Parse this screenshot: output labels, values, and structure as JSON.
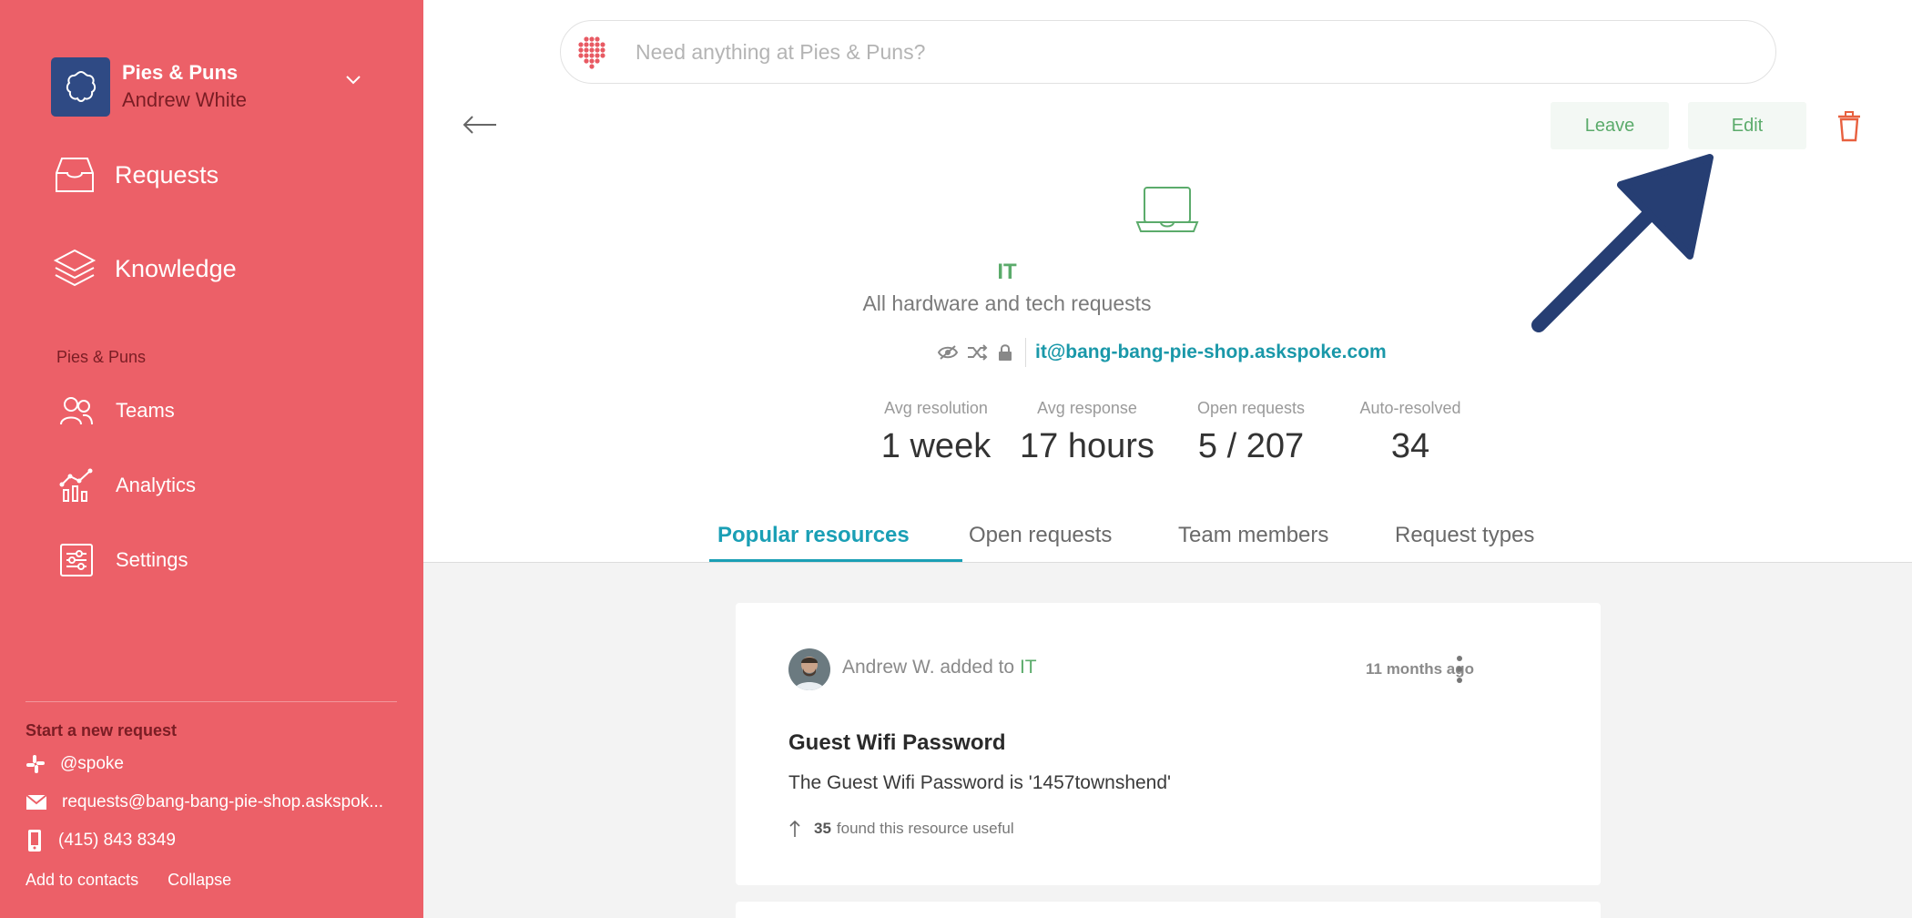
{
  "sidebar": {
    "org_name": "Pies & Puns",
    "user_name": "Andrew White",
    "nav_main": [
      {
        "label": "Requests",
        "icon": "inbox-icon"
      },
      {
        "label": "Knowledge",
        "icon": "layers-icon"
      }
    ],
    "section_label": "Pies & Puns",
    "nav_sub": [
      {
        "label": "Teams",
        "icon": "people-icon"
      },
      {
        "label": "Analytics",
        "icon": "analytics-icon"
      },
      {
        "label": "Settings",
        "icon": "settings-sliders-icon"
      }
    ],
    "start_request_title": "Start a new request",
    "contacts": [
      {
        "label": "@spoke",
        "icon": "slack-icon"
      },
      {
        "label": "requests@bang-bang-pie-shop.askspok...",
        "icon": "mail-icon"
      },
      {
        "label": "(415) 843 8349",
        "icon": "phone-icon"
      }
    ],
    "add_to_contacts": "Add to contacts",
    "collapse": "Collapse"
  },
  "search": {
    "placeholder": "Need anything at Pies & Puns?"
  },
  "header": {
    "leave_label": "Leave",
    "edit_label": "Edit"
  },
  "team": {
    "name": "IT",
    "description": "All hardware and tech requests",
    "email": "it@bang-bang-pie-shop.askspoke.com"
  },
  "stats": [
    {
      "label": "Avg resolution",
      "value": "1 week"
    },
    {
      "label": "Avg response",
      "value": "17 hours"
    },
    {
      "label": "Open requests",
      "value": "5 / 207"
    },
    {
      "label": "Auto-resolved",
      "value": "34"
    }
  ],
  "tabs": [
    {
      "label": "Popular resources",
      "active": true
    },
    {
      "label": "Open requests",
      "active": false
    },
    {
      "label": "Team members",
      "active": false
    },
    {
      "label": "Request types",
      "active": false
    }
  ],
  "resource": {
    "author_text": "Andrew W. added to",
    "team_link": "IT",
    "time": "11 months ago",
    "title": "Guest Wifi Password",
    "body": "The Guest Wifi Password is '1457townshend'",
    "useful_count": "35",
    "useful_text": "found this resource useful"
  },
  "colors": {
    "sidebar": "#ec6068",
    "accent_green": "#5bab6b",
    "accent_teal": "#1a9fb5",
    "annotation_arrow": "#263e73"
  }
}
